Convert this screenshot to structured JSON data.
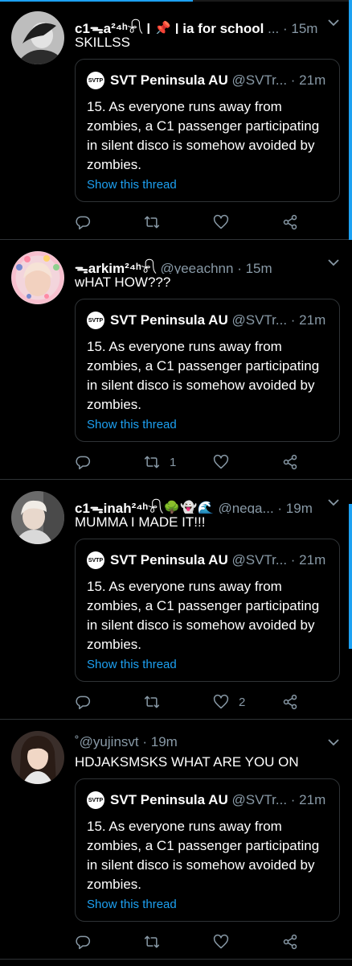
{
  "tweets": [
    {
      "display_name": "c1ᯓa²⁴ʰ𓍯 | 📌 | ia for school",
      "handle": "...",
      "time": "· 15m",
      "text": "SKILLSS",
      "quote": {
        "logo_text": "SVTP",
        "name": "SVT Peninsula AU",
        "handle": "@SVTr...",
        "time": "· 21m",
        "body": "15. As everyone runs away from zombies, a C1 passenger participating in silent disco is somehow avoided by zombies.",
        "show_thread": "Show this thread"
      },
      "retweets": "",
      "likes": ""
    },
    {
      "display_name": "ᯓarkim²⁴ʰ𓍯",
      "handle": "@yeeachnn",
      "time": "· 15m",
      "text": "wHAT HOW???",
      "quote": {
        "logo_text": "SVTP",
        "name": "SVT Peninsula AU",
        "handle": "@SVTr...",
        "time": "· 21m",
        "body": "15. As everyone runs away from zombies, a C1 passenger participating in silent disco is somehow avoided by zombies.",
        "show_thread": "Show this thread"
      },
      "retweets": "1",
      "likes": ""
    },
    {
      "display_name": "c1ᯓinah²⁴ʰ𓍯🌳👻🌊",
      "handle": "@nega...",
      "time": "· 19m",
      "text": "MUMMA I MADE IT!!!",
      "quote": {
        "logo_text": "SVTP",
        "name": "SVT Peninsula AU",
        "handle": "@SVTr...",
        "time": "· 21m",
        "body": "15. As everyone runs away from zombies, a C1 passenger participating in silent disco is somehow avoided by zombies.",
        "show_thread": "Show this thread"
      },
      "retweets": "",
      "likes": "2"
    },
    {
      "display_name": "˚",
      "handle": "@yujinsvt",
      "time": "· 19m",
      "text": "HDJAKSMSKS WHAT ARE YOU ON",
      "quote": {
        "logo_text": "SVTP",
        "name": "SVT Peninsula AU",
        "handle": "@SVTr...",
        "time": "· 21m",
        "body": "15. As everyone runs away from zombies, a C1 passenger participating in silent disco is somehow avoided by zombies.",
        "show_thread": "Show this thread"
      },
      "retweets": "",
      "likes": ""
    }
  ],
  "colors": {
    "accent": "#1da1f2",
    "secondary_text": "#8899a6",
    "border": "#2f3336",
    "background": "#000000"
  },
  "icons": [
    "reply-icon",
    "retweet-icon",
    "like-icon",
    "share-icon",
    "chevron-down-icon"
  ]
}
